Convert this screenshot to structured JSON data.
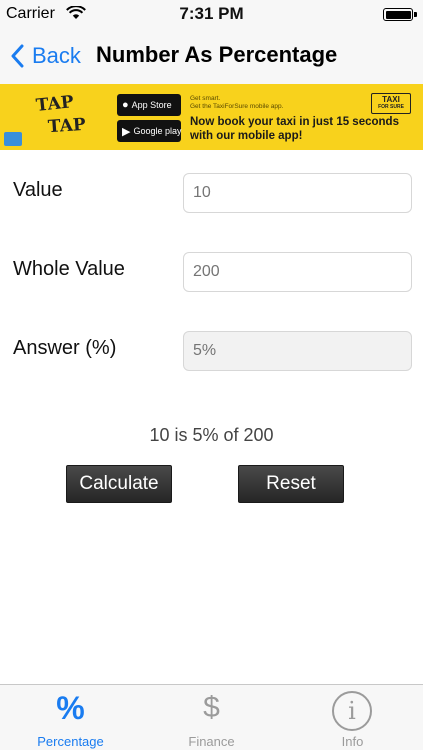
{
  "status_bar": {
    "carrier": "Carrier",
    "time": "7:31 PM",
    "battery_level": 1.0
  },
  "nav": {
    "back_label": "Back",
    "title": "Number As Percentage"
  },
  "ad": {
    "logo_line1": "TAP",
    "logo_line2": "TAP",
    "app_store_label": "App Store",
    "google_play_label": "Google play",
    "small_text_line1": "Get smart.",
    "small_text_line2": "Get the TaxiForSure mobile app.",
    "headline_line1": "Now book your taxi in just 15 seconds",
    "headline_line2": "with our mobile app!",
    "badge_line1": "TAXI",
    "badge_line2": "FOR SURE"
  },
  "form": {
    "value": {
      "label": "Value",
      "placeholder": "10"
    },
    "whole_value": {
      "label": "Whole Value",
      "placeholder": "200"
    },
    "answer": {
      "label": "Answer (%)",
      "placeholder": "5%"
    }
  },
  "result": "10 is 5% of 200",
  "buttons": {
    "calculate": "Calculate",
    "reset": "Reset"
  },
  "tabs": [
    {
      "icon": "%",
      "label": "Percentage",
      "active": true
    },
    {
      "icon": "$",
      "label": "Finance",
      "active": false
    },
    {
      "icon": "i",
      "label": "Info",
      "active": false
    }
  ],
  "colors": {
    "accent": "#1a7cf0",
    "ad_background": "#f8d21c",
    "button_dark": "#262626"
  }
}
